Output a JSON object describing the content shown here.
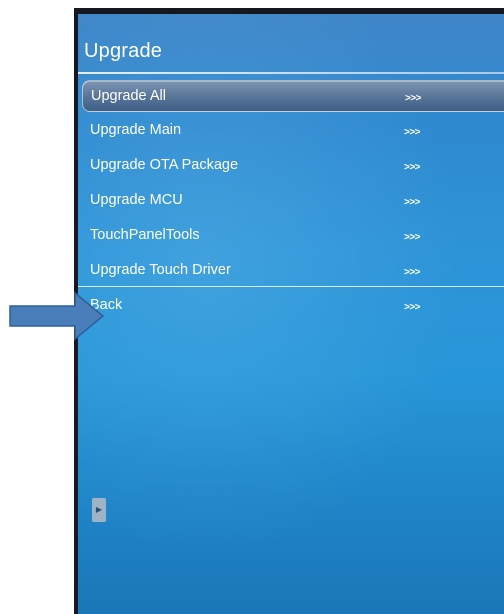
{
  "menu": {
    "title": "Upgrade",
    "items": [
      {
        "label": "Upgrade All",
        "arrows": ">>>",
        "selected": true
      },
      {
        "label": "Upgrade Main",
        "arrows": ">>>",
        "selected": false
      },
      {
        "label": "Upgrade OTA Package",
        "arrows": ">>>",
        "selected": false
      },
      {
        "label": "Upgrade MCU",
        "arrows": ">>>",
        "selected": false
      },
      {
        "label": "TouchPanelTools",
        "arrows": ">>>",
        "selected": false
      },
      {
        "label": "Upgrade Touch Driver",
        "arrows": ">>>",
        "selected": false
      },
      {
        "label": "Back",
        "arrows": ">>>",
        "selected": false
      }
    ]
  },
  "side_tab": {
    "icon": "chevron-right-icon",
    "glyph": "▶"
  },
  "annotation": {
    "icon": "arrow-right-icon",
    "color": "#4a7ebb"
  },
  "colors": {
    "screen_blue": "#2d94d8",
    "selected_bar": "#5a7699",
    "text": "#ffffff"
  }
}
